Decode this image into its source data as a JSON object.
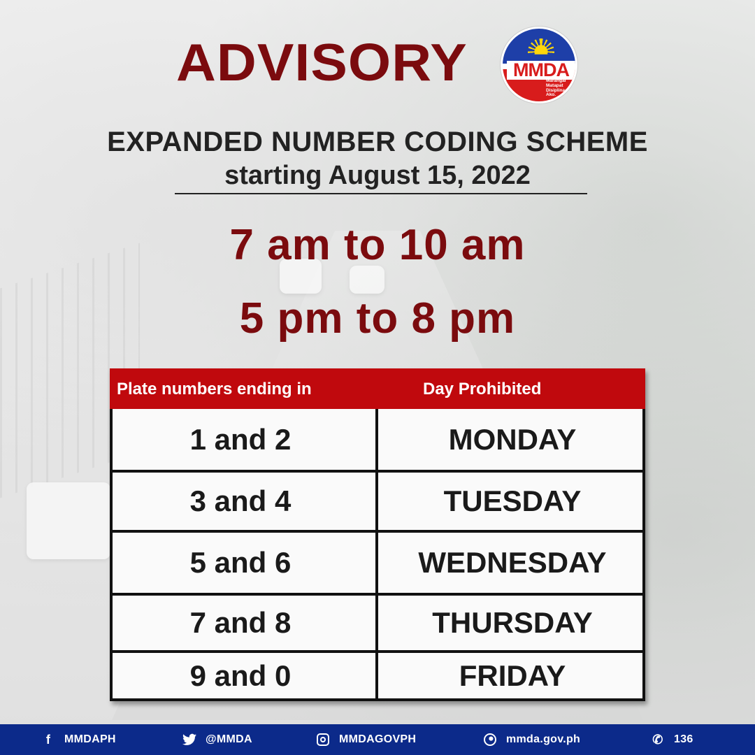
{
  "header": {
    "title": "ADVISORY",
    "logo": {
      "text": "MMDA",
      "motto": [
        "Marangal",
        "Matapat",
        "Disiplinado",
        "Ako."
      ]
    },
    "subtitle": "EXPANDED NUMBER CODING SCHEME",
    "start_date": "starting August 15, 2022"
  },
  "hours": [
    "7 am to 10 am",
    "5 pm to 8 pm"
  ],
  "table": {
    "headers": [
      "Plate numbers ending in",
      "Day Prohibited"
    ],
    "rows": [
      {
        "plates": "1 and 2",
        "day": "MONDAY"
      },
      {
        "plates": "3 and 4",
        "day": "TUESDAY"
      },
      {
        "plates": "5 and 6",
        "day": "WEDNESDAY"
      },
      {
        "plates": "7 and 8",
        "day": "THURSDAY"
      },
      {
        "plates": "9 and 0",
        "day": "FRIDAY"
      }
    ]
  },
  "footer": {
    "items": [
      {
        "icon": "facebook-icon",
        "glyph": "f",
        "label": "MMDAPH"
      },
      {
        "icon": "twitter-icon",
        "glyph": "🐦",
        "label": "@MMDA"
      },
      {
        "icon": "instagram-icon",
        "glyph": "",
        "label": "MMDAGOVPH"
      },
      {
        "icon": "globe-icon",
        "glyph": "",
        "label": "mmda.gov.ph"
      },
      {
        "icon": "phone-icon",
        "glyph": "✆",
        "label": "136"
      }
    ]
  },
  "colors": {
    "title_red": "#7b0b0e",
    "table_header_red": "#c0090d",
    "footer_blue": "#0c2a8a"
  }
}
